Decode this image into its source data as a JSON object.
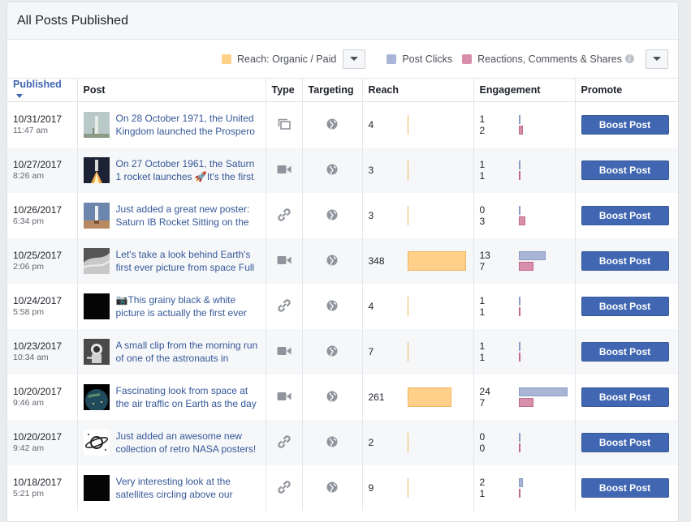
{
  "header": {
    "title": "All Posts Published"
  },
  "legend": {
    "reach_label": "Reach: Organic / Paid",
    "clicks_label": "Post Clicks",
    "reactions_label": "Reactions, Comments & Shares",
    "info_glyph": "i",
    "colors": {
      "reach": "#ffd08a",
      "clicks": "#a8b5d6",
      "reactions": "#d88fa9"
    }
  },
  "columns": {
    "published": "Published",
    "post": "Post",
    "type": "Type",
    "targeting": "Targeting",
    "reach": "Reach",
    "engagement": "Engagement",
    "promote": "Promote"
  },
  "boost_label": "Boost Post",
  "scale": {
    "reach_max": 348,
    "engagement_max": 24
  },
  "rows": [
    {
      "date": "10/31/2017",
      "time": "11:47 am",
      "post": "On 28 October 1971, the United Kingdom launched the Prospero",
      "type": "album-icon",
      "thumb": "rocket-pale",
      "reach": 4,
      "clicks": 1,
      "reactions": 2
    },
    {
      "date": "10/27/2017",
      "time": "8:26 am",
      "post": "On 27 October 1961, the Saturn 1 rocket launches 🚀It's the first",
      "type": "video-icon",
      "thumb": "rocket-night",
      "reach": 3,
      "clicks": 1,
      "reactions": 1
    },
    {
      "date": "10/26/2017",
      "time": "6:34 pm",
      "post": "Just added a great new poster: Saturn IB Rocket Sitting on the",
      "type": "link-icon",
      "thumb": "rocket-sky",
      "reach": 3,
      "clicks": 0,
      "reactions": 3
    },
    {
      "date": "10/25/2017",
      "time": "2:06 pm",
      "post": "Let's take a look behind Earth's first ever picture from space Full",
      "type": "video-icon",
      "thumb": "earth-gray",
      "reach": 348,
      "clicks": 13,
      "reactions": 7
    },
    {
      "date": "10/24/2017",
      "time": "5:58 pm",
      "post": "📷This grainy black & white picture is actually the first ever",
      "type": "link-icon",
      "thumb": "black",
      "reach": 4,
      "clicks": 1,
      "reactions": 1
    },
    {
      "date": "10/23/2017",
      "time": "10:34 am",
      "post": "A small clip from the morning run of one of the astronauts in",
      "type": "video-icon",
      "thumb": "astronaut",
      "reach": 7,
      "clicks": 1,
      "reactions": 1
    },
    {
      "date": "10/20/2017",
      "time": "9:46 am",
      "post": "Fascinating look from space at the air traffic on Earth as the day",
      "type": "video-icon",
      "thumb": "earth-space",
      "reach": 261,
      "clicks": 24,
      "reactions": 7
    },
    {
      "date": "10/20/2017",
      "time": "9:42 am",
      "post": "Just added an awesome new collection of retro NASA posters!",
      "type": "link-icon",
      "thumb": "planet-logo",
      "reach": 2,
      "clicks": 0,
      "reactions": 0
    },
    {
      "date": "10/18/2017",
      "time": "5:21 pm",
      "post": "Very interesting look at the satellites circling above our",
      "type": "link-icon",
      "thumb": "black",
      "reach": 9,
      "clicks": 2,
      "reactions": 1
    }
  ]
}
